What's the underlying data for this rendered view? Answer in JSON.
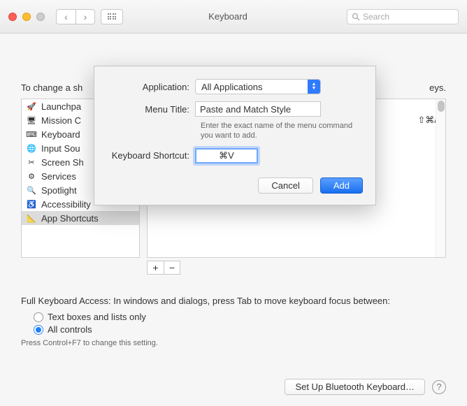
{
  "titlebar": {
    "title": "Keyboard",
    "search_placeholder": "Search"
  },
  "intro": "To change a sh",
  "intro_suffix": "eys.",
  "sidebar": {
    "items": [
      {
        "label": "Launchpa",
        "icon": "🚀"
      },
      {
        "label": "Mission C",
        "icon": "🖥"
      },
      {
        "label": "Keyboard",
        "icon": "⌨"
      },
      {
        "label": "Input Sou",
        "icon": "🌐"
      },
      {
        "label": "Screen Sh",
        "icon": "✂"
      },
      {
        "label": "Services",
        "icon": "⚙"
      },
      {
        "label": "Spotlight",
        "icon": "🔍"
      },
      {
        "label": "Accessibility",
        "icon": "♿"
      },
      {
        "label": "App Shortcuts",
        "icon": "📐"
      }
    ],
    "selected_index": 8
  },
  "right_shortcut": "⇧⌘/",
  "pm": {
    "plus": "+",
    "minus": "−"
  },
  "fka": {
    "text": "Full Keyboard Access: In windows and dialogs, press Tab to move keyboard focus between:",
    "options": [
      "Text boxes and lists only",
      "All controls"
    ],
    "selected": 1,
    "hint": "Press Control+F7 to change this setting."
  },
  "footer": {
    "bluetooth": "Set Up Bluetooth Keyboard…"
  },
  "sheet": {
    "labels": {
      "app": "Application:",
      "menu": "Menu Title:",
      "shortcut": "Keyboard Shortcut:"
    },
    "app_value": "All Applications",
    "menu_value": "Paste and Match Style",
    "menu_help": "Enter the exact name of the menu command you want to add.",
    "shortcut_value": "⌘V",
    "cancel": "Cancel",
    "add": "Add"
  }
}
